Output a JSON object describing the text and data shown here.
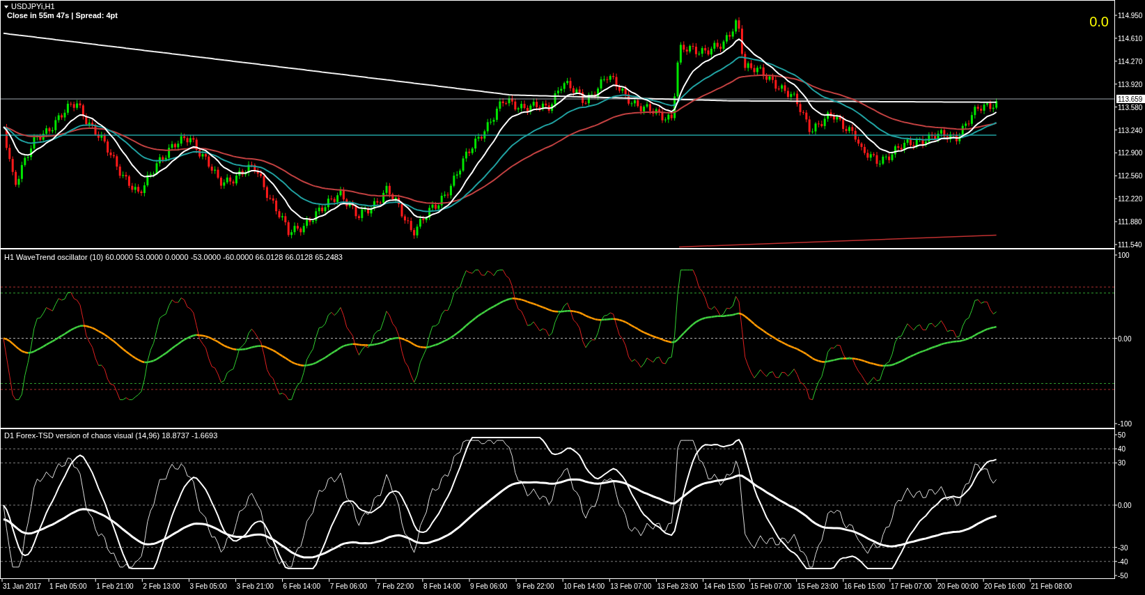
{
  "chart": {
    "symbol": "USDJPYi,H1",
    "info": "Close in 55m 47s | Spread: 4pt",
    "corner_value": "0.0",
    "current_price": "113.659",
    "price_axis": [
      "114.950",
      "114.610",
      "114.270",
      "113.920",
      "113.580",
      "113.240",
      "112.900",
      "112.560",
      "112.220",
      "111.880",
      "111.540"
    ]
  },
  "oscillator": {
    "title": "H1 WaveTrend oscillator (10) 60.0000 53.0000 0.0000 -53.0000 -60.0000 66.0128 66.0128 65.2483",
    "axis": [
      "100",
      "0.00",
      "-100"
    ]
  },
  "chaos": {
    "title": "D1 Forex-TSD version of chaos visual (14,96) 18.8737 -1.6693",
    "axis": [
      "50",
      "40",
      "30",
      "0.00",
      "-30",
      "-40",
      "-50"
    ]
  },
  "time_axis": [
    "31 Jan 2017",
    "1 Feb 05:00",
    "1 Feb 21:00",
    "2 Feb 13:00",
    "3 Feb 05:00",
    "3 Feb 21:00",
    "6 Feb 14:00",
    "7 Feb 06:00",
    "7 Feb 22:00",
    "8 Feb 14:00",
    "9 Feb 06:00",
    "9 Feb 22:00",
    "10 Feb 14:00",
    "13 Feb 07:00",
    "13 Feb 23:00",
    "14 Feb 15:00",
    "15 Feb 07:00",
    "15 Feb 23:00",
    "16 Feb 15:00",
    "17 Feb 07:00",
    "20 Feb 00:00",
    "20 Feb 16:00",
    "21 Feb 08:00"
  ]
}
